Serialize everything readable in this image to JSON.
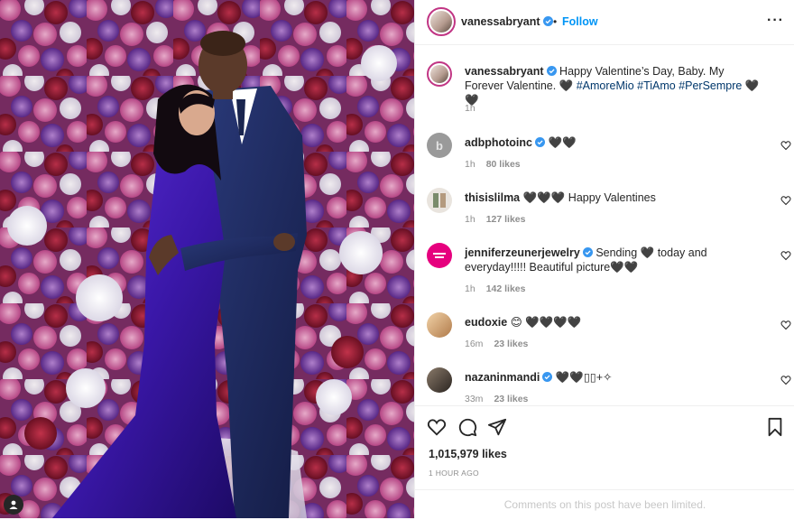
{
  "post": {
    "username": "vanessabryant",
    "follow_label": "Follow",
    "dot": "•",
    "more_label": "···"
  },
  "caption": {
    "username": "vanessabryant",
    "text": "Happy Valentine’s Day, Baby. My Forever Valentine. 🖤",
    "hashtags": "#AmoreMio #TiAmo #PerSempre",
    "trail": "🖤🖤",
    "time": "1h"
  },
  "comments": [
    {
      "username": "adbphotoinc",
      "verified": true,
      "text": "🖤🖤",
      "time": "1h",
      "likes": "80 likes"
    },
    {
      "username": "thisislilma",
      "verified": false,
      "text": "🖤🖤🖤 Happy Valentines",
      "time": "1h",
      "likes": "127 likes"
    },
    {
      "username": "jenniferzeunerjewelry",
      "verified": true,
      "text": "Sending 🖤 today and everyday!!!!! Beautiful picture🖤🖤",
      "time": "1h",
      "likes": "142 likes"
    },
    {
      "username": "eudoxie",
      "verified": false,
      "text": "😊 🖤🖤🖤🖤",
      "time": "16m",
      "likes": "23 likes"
    },
    {
      "username": "nazaninmandi",
      "verified": true,
      "text": "🖤🖤▯▯+✧",
      "time": "33m",
      "likes": "23 likes"
    }
  ],
  "actions": {
    "likes": "1,015,979 likes",
    "posted_ago": "1 HOUR AGO",
    "comments_limited": "Comments on this post have been limited."
  },
  "colors": {
    "accent": "#0095f6",
    "verified": "#3897f0",
    "muted": "#8e8e8e",
    "hashtag": "#00376b"
  },
  "icons": [
    "user-tag-icon",
    "verified-badge-icon",
    "more-options-icon",
    "heart-icon",
    "comment-icon",
    "share-icon",
    "save-bookmark-icon"
  ]
}
